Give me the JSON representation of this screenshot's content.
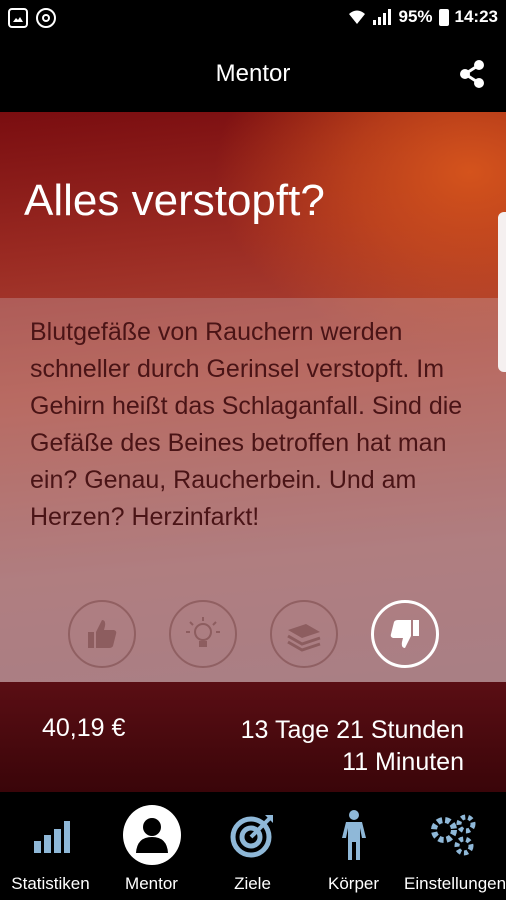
{
  "status_bar": {
    "left_icons": [
      "image-notification-icon",
      "sync-notification-icon"
    ],
    "battery": "95%",
    "time": "14:23"
  },
  "app_bar": {
    "title": "Mentor",
    "share_icon": "share-icon"
  },
  "content": {
    "title": "Alles verstopft?",
    "body": "Blutgefäße von Rauchern werden schneller durch Gerinsel verstopft. Im Gehirn heißt das Schlaganfall. Sind die Gefäße des Beines betroffen hat man ein? Genau, Raucherbein. Und am Herzen? Herzinfarkt!",
    "actions": [
      {
        "icon": "thumbs-up-icon",
        "active": false
      },
      {
        "icon": "lightbulb-icon",
        "active": false
      },
      {
        "icon": "money-stack-icon",
        "active": false
      },
      {
        "icon": "thumbs-down-icon",
        "active": true
      }
    ]
  },
  "stats": {
    "money_saved": "40,19 €",
    "time_line1": "13 Tage 21 Stunden",
    "time_line2": "11 Minuten"
  },
  "bottom_nav": {
    "items": [
      {
        "label": "Statistiken",
        "icon": "bar-chart-icon"
      },
      {
        "label": "Mentor",
        "icon": "person-icon",
        "active": true
      },
      {
        "label": "Ziele",
        "icon": "target-icon"
      },
      {
        "label": "Körper",
        "icon": "body-icon"
      },
      {
        "label": "Einstellungen",
        "icon": "gears-icon"
      }
    ]
  },
  "colors": {
    "accent_icon": "#8fb8d8",
    "body_text": "#4a1416",
    "hero_dark_red": "#7a0d10",
    "hero_orange": "#d4531c",
    "stats_bg": "#4a0a10"
  }
}
